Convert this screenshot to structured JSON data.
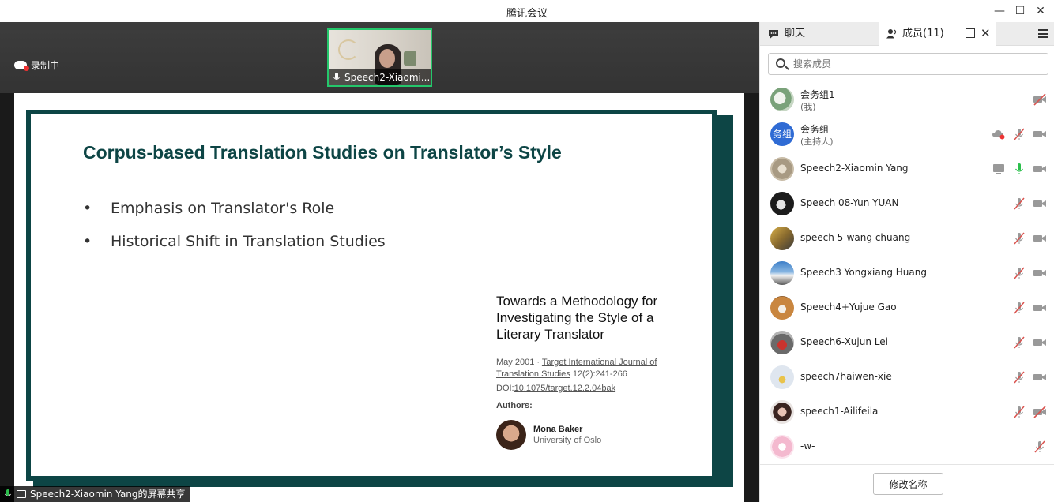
{
  "app": {
    "title": "腾讯会议"
  },
  "recording": {
    "label": "录制中"
  },
  "speaker_thumb": {
    "name": "Speech2-Xiaomi..."
  },
  "slide": {
    "title": "Corpus-based Translation Studies on Translator’s Style",
    "bullets": [
      "Emphasis on Translator's Role",
      "Historical Shift in Translation Studies"
    ],
    "paper_title": "Towards a Methodology for Investigating the Style of a Literary Translator",
    "paper_date": "May 2001 · ",
    "paper_journal": "Target International Journal of Translation Studies",
    "paper_pages": " 12(2):241-266",
    "doi_label": "DOI:",
    "doi_value": "10.1075/target.12.2.04bak",
    "authors_label": "Authors:",
    "author_name": "Mona Baker",
    "author_affil": "University of Oslo"
  },
  "share_label": "Speech2-Xiaomin Yang的屏幕共享",
  "panel": {
    "tab_chat": "聊天",
    "tab_members": "成员(11)",
    "search_placeholder": "搜索成员",
    "rename_button": "修改名称"
  },
  "members": [
    {
      "name": "会务组1",
      "role": "(我)"
    },
    {
      "name": "会务组",
      "role": "(主持人)",
      "avatar_text": "务组"
    },
    {
      "name": "Speech2-Xiaomin Yang"
    },
    {
      "name": "Speech 08-Yun YUAN"
    },
    {
      "name": "speech 5-wang chuang"
    },
    {
      "name": "Speech3 Yongxiang Huang"
    },
    {
      "name": "Speech4+Yujue Gao"
    },
    {
      "name": "Speech6-Xujun Lei"
    },
    {
      "name": "speech7haiwen-xie"
    },
    {
      "name": "speech1-Ailifeila"
    },
    {
      "name": "-w-"
    }
  ],
  "colors": {
    "accent": "#0d4545",
    "active_speaker": "#24c76b",
    "mic_on": "#2bbf4c",
    "muted": "#d9534f",
    "avatar_host": "#2f6bd4"
  },
  "icons": [
    "chat-icon",
    "members-icon",
    "popout-icon",
    "close-icon",
    "menu-icon",
    "search-icon",
    "mic-icon",
    "mic-muted-icon",
    "camera-icon",
    "camera-off-icon",
    "screen-share-icon",
    "recording-cloud-icon"
  ]
}
